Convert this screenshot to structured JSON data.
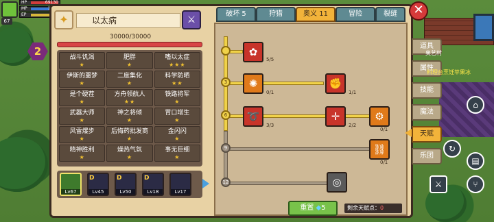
{
  "hud": {
    "level": "67",
    "hp_label": "HP",
    "hp_value": "69130",
    "mp_label": "MP",
    "mp_value": "1800",
    "ep_label": "EP",
    "ep_value": "46"
  },
  "stage_badge": "2",
  "boss": {
    "name": "以太病",
    "hp_text": "30000/30000",
    "hp_fraction": 1.0
  },
  "traits": [
    {
      "name": "战斗饥渴",
      "stars": "★"
    },
    {
      "name": "肥胖",
      "stars": "★"
    },
    {
      "name": "嗜以太症",
      "stars": "★★★"
    },
    {
      "name": "伊斯的噩梦",
      "stars": "★"
    },
    {
      "name": "二度集化",
      "stars": "★"
    },
    {
      "name": "科学防晒",
      "stars": "★★"
    },
    {
      "name": "是个硬茬",
      "stars": "★"
    },
    {
      "name": "方舟领航人",
      "stars": "★★"
    },
    {
      "name": "铁路将军",
      "stars": "★"
    },
    {
      "name": "武器大师",
      "stars": "★"
    },
    {
      "name": "神之将倾",
      "stars": "★"
    },
    {
      "name": "胃口增生",
      "stars": "★"
    },
    {
      "name": "风雷爆步",
      "stars": "★"
    },
    {
      "name": "后悔药批发商",
      "stars": "★"
    },
    {
      "name": "金闪闪",
      "stars": "★"
    },
    {
      "name": "精神胜利",
      "stars": "★"
    },
    {
      "name": "燥热气氛",
      "stars": "★"
    },
    {
      "name": "事无巨细",
      "stars": "★"
    }
  ],
  "party": [
    {
      "rank": "",
      "lv": "Lv67"
    },
    {
      "rank": "D",
      "lv": "Lv45"
    },
    {
      "rank": "D",
      "lv": "Lv50"
    },
    {
      "rank": "D",
      "lv": "Lv18"
    },
    {
      "rank": "",
      "lv": "Lv17"
    }
  ],
  "tabs": [
    "破坏 5",
    "狩猎",
    "奥义 11",
    "冒险",
    "裂缝"
  ],
  "tree": {
    "levels": [
      "",
      "3",
      "6",
      "9",
      "12"
    ],
    "counts": [
      "5/5",
      "0/1",
      "1/1",
      "3/3",
      "2/2",
      "0/1",
      "0/1"
    ]
  },
  "reset": {
    "label": "重置",
    "cost": "5"
  },
  "points": {
    "label": "剩余天赋点：",
    "value": "0"
  },
  "side_tabs": [
    "道具",
    "属性",
    "技能",
    "魔法",
    "天赋",
    "乐团"
  ],
  "village": "奥艺村",
  "ticker": "料理台烹饪苹果冰",
  "colors": {
    "accent": "#f2b33a",
    "panel": "#e8d2a4",
    "hp": "#d84646",
    "track_on": "#f0d24a"
  }
}
